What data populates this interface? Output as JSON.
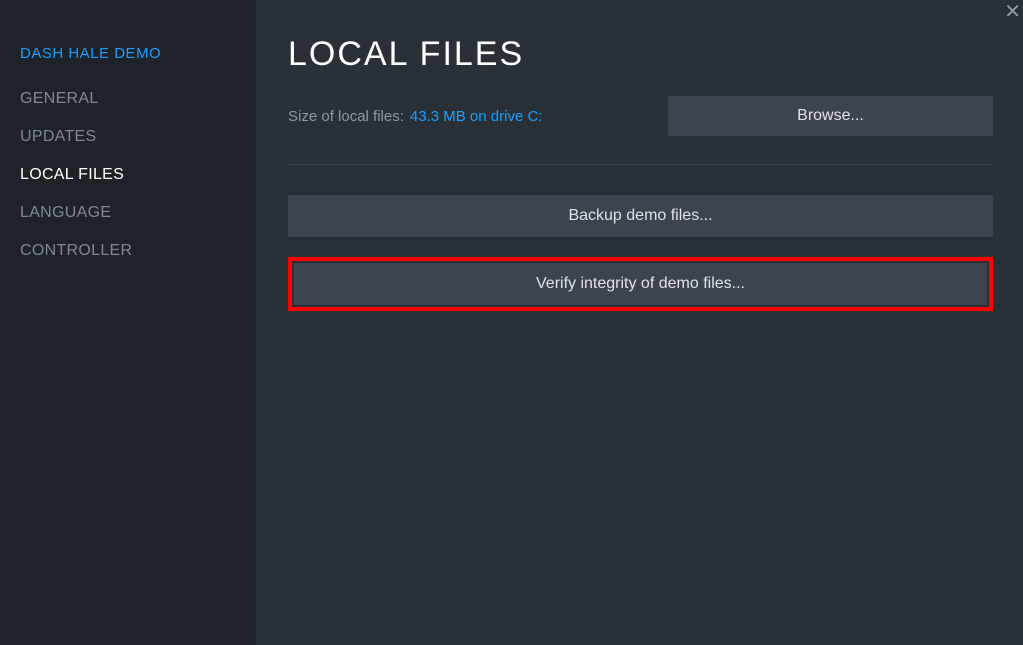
{
  "sidebar": {
    "game_title": "DASH HALE DEMO",
    "items": [
      {
        "label": "GENERAL",
        "active": false
      },
      {
        "label": "UPDATES",
        "active": false
      },
      {
        "label": "LOCAL FILES",
        "active": true
      },
      {
        "label": "LANGUAGE",
        "active": false
      },
      {
        "label": "CONTROLLER",
        "active": false
      }
    ]
  },
  "main": {
    "title": "LOCAL FILES",
    "size_label": "Size of local files:",
    "size_value": "43.3 MB on drive C:",
    "browse_label": "Browse...",
    "backup_label": "Backup demo files...",
    "verify_label": "Verify integrity of demo files..."
  }
}
